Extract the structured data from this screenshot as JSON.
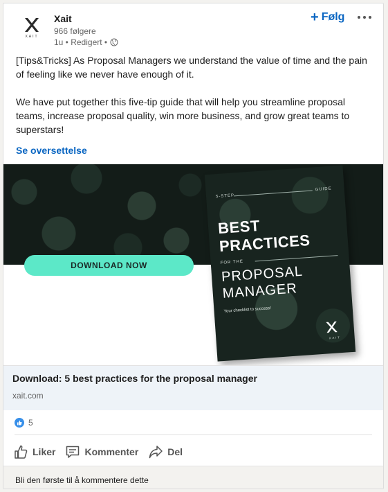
{
  "post": {
    "company": "Xait",
    "logo_word": "XAIT",
    "followers": "966 følgere",
    "meta": "1u • Redigert •",
    "follow_label": "Følg",
    "text_p1": "[Tips&Tricks] As Proposal Managers we understand the value of time and the pain of feeling like we never have enough of it.",
    "text_p2": "We have put together this five-tip guide that will help you streamline proposal teams, increase proposal quality, win more business, and grow great teams to superstars!",
    "translate_label": "Se oversettelse"
  },
  "banner": {
    "button_label": "DOWNLOAD NOW",
    "book": {
      "step": "5-STEP",
      "guide": "GUIDE",
      "best": "BEST",
      "practices": "PRACTICES",
      "for_the": "FOR THE",
      "proposal": "PROPOSAL",
      "manager": "MANAGER",
      "checklist": "Your checklist to success!",
      "logo_word": "XAIT"
    }
  },
  "link": {
    "title": "Download: 5 best practices for the proposal manager",
    "domain": "xait.com"
  },
  "reactions": {
    "count": "5"
  },
  "actions": {
    "like": "Liker",
    "comment": "Kommenter",
    "share": "Del"
  },
  "comment_prompt": "Bli den første til å kommentere dette",
  "colors": {
    "accent": "#0a66c2",
    "button": "#5ce8c8",
    "like_badge": "#378fe9"
  }
}
